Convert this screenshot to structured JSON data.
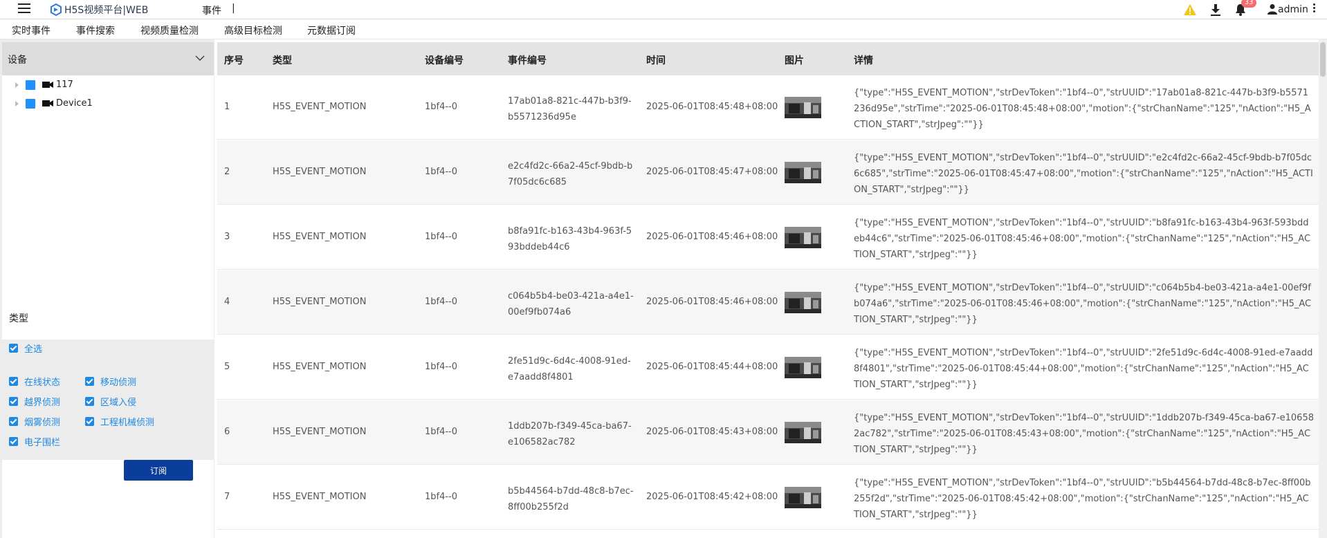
{
  "header": {
    "logo_text": "H5S视频平台|WEB",
    "page_title": "事件",
    "title_separator": "|",
    "notification_count": "33",
    "user_name": "admin",
    "warn_color": "#f5c518",
    "badge_color": "#f56c6c"
  },
  "tabs": [
    {
      "label": "实时事件"
    },
    {
      "label": "事件搜索"
    },
    {
      "label": "视频质量检测"
    },
    {
      "label": "高级目标检测"
    },
    {
      "label": "元数据订阅"
    }
  ],
  "sidebar": {
    "device_title": "设备",
    "devices": [
      {
        "label": "117"
      },
      {
        "label": "Device1"
      }
    ],
    "type_title": "类型",
    "select_all": "全选",
    "types": [
      {
        "label": "在线状态"
      },
      {
        "label": "移动侦测"
      },
      {
        "label": "越界侦测"
      },
      {
        "label": "区域入侵"
      },
      {
        "label": "烟雾侦测"
      },
      {
        "label": "工程机械侦测"
      },
      {
        "label": "电子围栏"
      }
    ],
    "subscribe_label": "订阅",
    "accent_color": "#1e88e5",
    "button_color": "#0b3e9a"
  },
  "table": {
    "columns": [
      "序号",
      "类型",
      "设备编号",
      "事件编号",
      "时间",
      "图片",
      "详情"
    ],
    "rows": [
      {
        "index": "1",
        "type": "H5S_EVENT_MOTION",
        "device": "1bf4--0",
        "event_id": "17ab01a8-821c-447b-b3f9-b5571236d95e",
        "time": "2025-06-01T08:45:48+08:00",
        "detail": "{\"type\":\"H5S_EVENT_MOTION\",\"strDevToken\":\"1bf4--0\",\"strUUID\":\"17ab01a8-821c-447b-b3f9-b5571236d95e\",\"strTime\":\"2025-06-01T08:45:48+08:00\",\"motion\":{\"strChanName\":\"125\",\"nAction\":\"H5_ACTION_START\",\"strJpeg\":\"\"}}"
      },
      {
        "index": "2",
        "type": "H5S_EVENT_MOTION",
        "device": "1bf4--0",
        "event_id": "e2c4fd2c-66a2-45cf-9bdb-b7f05dc6c685",
        "time": "2025-06-01T08:45:47+08:00",
        "detail": "{\"type\":\"H5S_EVENT_MOTION\",\"strDevToken\":\"1bf4--0\",\"strUUID\":\"e2c4fd2c-66a2-45cf-9bdb-b7f05dc6c685\",\"strTime\":\"2025-06-01T08:45:47+08:00\",\"motion\":{\"strChanName\":\"125\",\"nAction\":\"H5_ACTION_START\",\"strJpeg\":\"\"}}"
      },
      {
        "index": "3",
        "type": "H5S_EVENT_MOTION",
        "device": "1bf4--0",
        "event_id": "b8fa91fc-b163-43b4-963f-593bddeb44c6",
        "time": "2025-06-01T08:45:46+08:00",
        "detail": "{\"type\":\"H5S_EVENT_MOTION\",\"strDevToken\":\"1bf4--0\",\"strUUID\":\"b8fa91fc-b163-43b4-963f-593bddeb44c6\",\"strTime\":\"2025-06-01T08:45:46+08:00\",\"motion\":{\"strChanName\":\"125\",\"nAction\":\"H5_ACTION_START\",\"strJpeg\":\"\"}}"
      },
      {
        "index": "4",
        "type": "H5S_EVENT_MOTION",
        "device": "1bf4--0",
        "event_id": "c064b5b4-be03-421a-a4e1-00ef9fb074a6",
        "time": "2025-06-01T08:45:46+08:00",
        "detail": "{\"type\":\"H5S_EVENT_MOTION\",\"strDevToken\":\"1bf4--0\",\"strUUID\":\"c064b5b4-be03-421a-a4e1-00ef9fb074a6\",\"strTime\":\"2025-06-01T08:45:46+08:00\",\"motion\":{\"strChanName\":\"125\",\"nAction\":\"H5_ACTION_START\",\"strJpeg\":\"\"}}"
      },
      {
        "index": "5",
        "type": "H5S_EVENT_MOTION",
        "device": "1bf4--0",
        "event_id": "2fe51d9c-6d4c-4008-91ed-e7aadd8f4801",
        "time": "2025-06-01T08:45:44+08:00",
        "detail": "{\"type\":\"H5S_EVENT_MOTION\",\"strDevToken\":\"1bf4--0\",\"strUUID\":\"2fe51d9c-6d4c-4008-91ed-e7aadd8f4801\",\"strTime\":\"2025-06-01T08:45:44+08:00\",\"motion\":{\"strChanName\":\"125\",\"nAction\":\"H5_ACTION_START\",\"strJpeg\":\"\"}}"
      },
      {
        "index": "6",
        "type": "H5S_EVENT_MOTION",
        "device": "1bf4--0",
        "event_id": "1ddb207b-f349-45ca-ba67-e106582ac782",
        "time": "2025-06-01T08:45:43+08:00",
        "detail": "{\"type\":\"H5S_EVENT_MOTION\",\"strDevToken\":\"1bf4--0\",\"strUUID\":\"1ddb207b-f349-45ca-ba67-e106582ac782\",\"strTime\":\"2025-06-01T08:45:43+08:00\",\"motion\":{\"strChanName\":\"125\",\"nAction\":\"H5_ACTION_START\",\"strJpeg\":\"\"}}"
      },
      {
        "index": "7",
        "type": "H5S_EVENT_MOTION",
        "device": "1bf4--0",
        "event_id": "b5b44564-b7dd-48c8-b7ec-8ff00b255f2d",
        "time": "2025-06-01T08:45:42+08:00",
        "detail": "{\"type\":\"H5S_EVENT_MOTION\",\"strDevToken\":\"1bf4--0\",\"strUUID\":\"b5b44564-b7dd-48c8-b7ec-8ff00b255f2d\",\"strTime\":\"2025-06-01T08:45:42+08:00\",\"motion\":{\"strChanName\":\"125\",\"nAction\":\"H5_ACTION_START\",\"strJpeg\":\"\"}}"
      }
    ]
  }
}
